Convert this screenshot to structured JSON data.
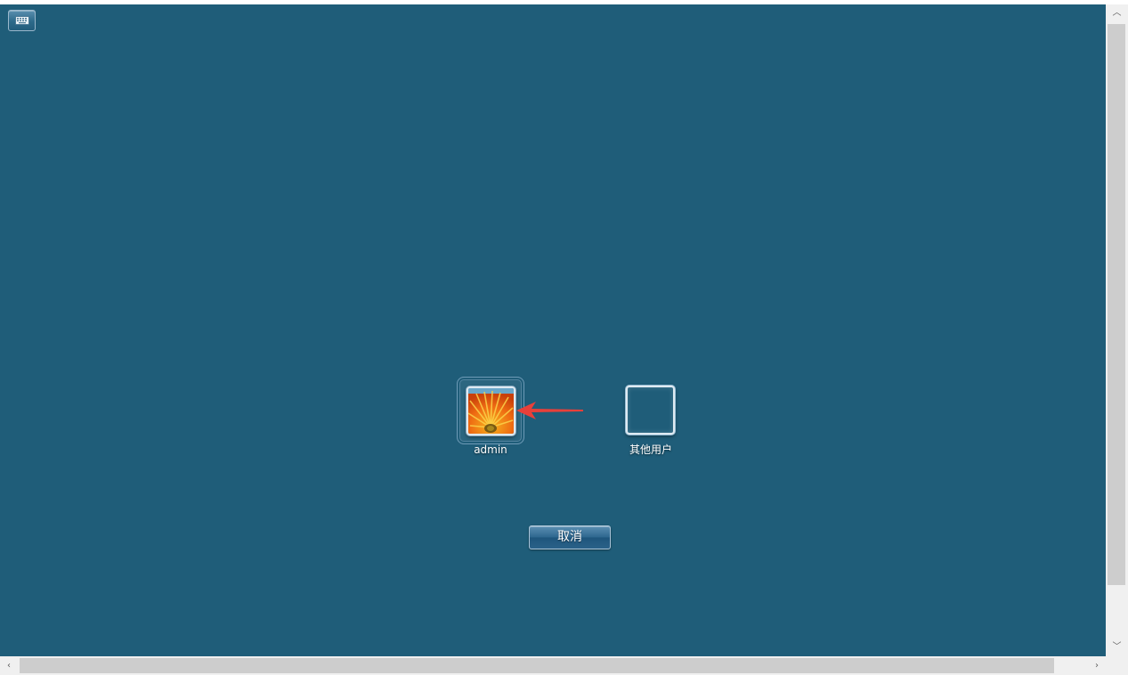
{
  "toolbar": {
    "keyboard_icon": "keyboard-icon"
  },
  "users": [
    {
      "name": "admin",
      "picture": "orange-flower",
      "selected": true
    },
    {
      "name": "其他用户",
      "picture": "blank",
      "selected": false
    }
  ],
  "actions": {
    "cancel_label": "取消"
  },
  "annotation": {
    "arrow_color": "#e8403a",
    "arrow_icon": "red-arrow-pointing-left"
  },
  "colors": {
    "background": "#1f5d79",
    "scrollbar_track": "#f0f0f0",
    "scrollbar_thumb": "#cdcdcd"
  },
  "scrollbars": {
    "up_glyph": "︿",
    "down_glyph": "﹀",
    "left_glyph": "‹",
    "right_glyph": "›"
  }
}
